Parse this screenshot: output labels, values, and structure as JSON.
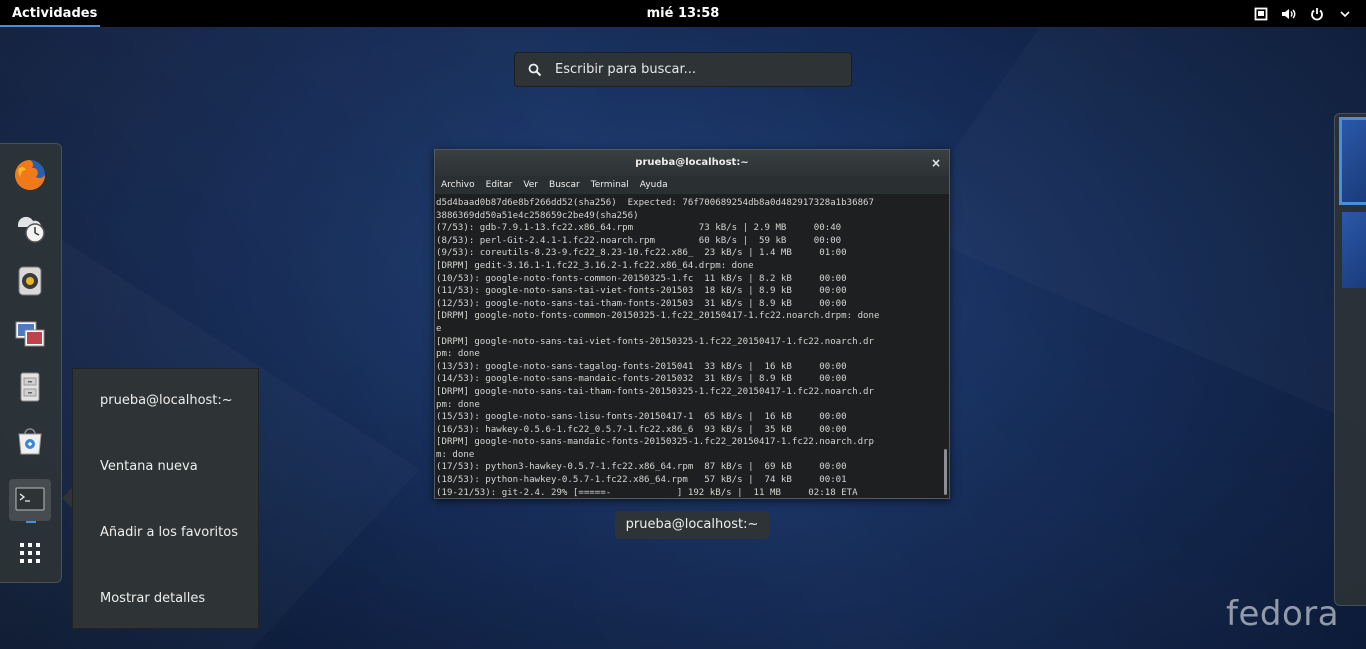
{
  "topbar": {
    "activities_label": "Actividades",
    "clock": "mié 13:58",
    "tray_icons": [
      "screen-icon",
      "volume-icon",
      "power-icon",
      "chevron-down-icon"
    ]
  },
  "search": {
    "placeholder": "Escribir para buscar..."
  },
  "dash": {
    "apps": [
      "firefox-icon",
      "clock-icon",
      "rhythmbox-icon",
      "image-viewer-icon",
      "file-manager-icon",
      "software-center-icon",
      "terminal-icon",
      "show-apps-icon"
    ]
  },
  "context_menu": {
    "items": [
      "prueba@localhost:~",
      "Ventana nueva",
      "Añadir a los favoritos",
      "Mostrar detalles"
    ]
  },
  "window": {
    "title": "prueba@localhost:~",
    "close_glyph": "×",
    "menu": [
      "Archivo",
      "Editar",
      "Ver",
      "Buscar",
      "Terminal",
      "Ayuda"
    ],
    "caption": "prueba@localhost:~",
    "terminal_lines": [
      "d5d4baad0b87d6e8bf266dd52(sha256)  Expected: 76f700689254db8a0d482917328a1b36867",
      "3886369dd50a51e4c258659c2be49(sha256)",
      "(7/53): gdb-7.9.1-13.fc22.x86_64.rpm            73 kB/s | 2.9 MB     00:40",
      "(8/53): perl-Git-2.4.1-1.fc22.noarch.rpm        60 kB/s |  59 kB     00:00",
      "(9/53): coreutils-8.23-9.fc22_8.23-10.fc22.x86_  23 kB/s | 1.4 MB     01:00",
      "[DRPM] gedit-3.16.1-1.fc22_3.16.2-1.fc22.x86_64.drpm: done",
      "(10/53): google-noto-fonts-common-20150325-1.fc  11 kB/s | 8.2 kB     00:00",
      "(11/53): google-noto-sans-tai-viet-fonts-201503  18 kB/s | 8.9 kB     00:00",
      "(12/53): google-noto-sans-tai-tham-fonts-201503  31 kB/s | 8.9 kB     00:00",
      "[DRPM] google-noto-fonts-common-20150325-1.fc22_20150417-1.fc22.noarch.drpm: done",
      "e",
      "[DRPM] google-noto-sans-tai-viet-fonts-20150325-1.fc22_20150417-1.fc22.noarch.dr",
      "pm: done",
      "(13/53): google-noto-sans-tagalog-fonts-2015041  33 kB/s |  16 kB     00:00",
      "(14/53): google-noto-sans-mandaic-fonts-2015032  31 kB/s | 8.9 kB     00:00",
      "[DRPM] google-noto-sans-tai-tham-fonts-20150325-1.fc22_20150417-1.fc22.noarch.dr",
      "pm: done",
      "(15/53): google-noto-sans-lisu-fonts-20150417-1  65 kB/s |  16 kB     00:00",
      "(16/53): hawkey-0.5.6-1.fc22_0.5.7-1.fc22.x86_6  93 kB/s |  35 kB     00:00",
      "[DRPM] google-noto-sans-mandaic-fonts-20150325-1.fc22_20150417-1.fc22.noarch.drp",
      "m: done",
      "(17/53): python3-hawkey-0.5.7-1.fc22.x86_64.rpm  87 kB/s |  69 kB     00:00",
      "(18/53): python-hawkey-0.5.7-1.fc22.x86_64.rpm   57 kB/s |  74 kB     00:01",
      "(19-21/53): git-2.4. 29% [=====-            ] 192 kB/s |  11 MB     02:18 ETA"
    ]
  },
  "brand": {
    "logo_text": "fedora"
  },
  "colors": {
    "accent": "#4a90d9",
    "panel": "#2e3436",
    "topbar": "#000000"
  }
}
